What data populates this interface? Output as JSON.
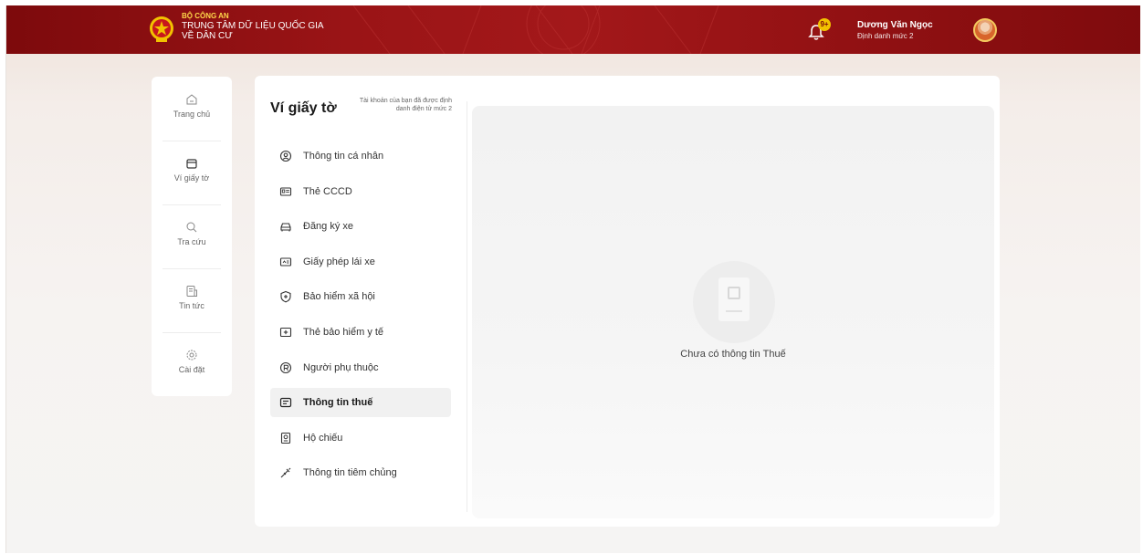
{
  "header": {
    "org_line1": "BỘ CÔNG AN",
    "org_line2": "TRUNG TÂM DỮ LIỆU QUỐC GIA",
    "org_line3": "VỀ DÂN CƯ",
    "notification_badge": "9+",
    "user_name": "Dương Văn Ngọc",
    "user_level": "Định danh mức 2",
    "colors": {
      "primary": "#9a1416",
      "accent": "#ffd84a"
    }
  },
  "leftnav": {
    "items": [
      {
        "label": "Trang chủ",
        "icon": "home-icon"
      },
      {
        "label": "Ví giấy tờ",
        "icon": "wallet-icon"
      },
      {
        "label": "Tra cứu",
        "icon": "search-icon"
      },
      {
        "label": "Tin tức",
        "icon": "news-icon"
      },
      {
        "label": "Cài đặt",
        "icon": "settings-icon"
      }
    ]
  },
  "panel": {
    "title": "Ví giấy tờ",
    "note": "Tài khoản của bạn đã được định danh điện tử mức 2",
    "menu": [
      {
        "label": "Thông tin cá nhân",
        "icon": "user-circle-icon",
        "active": false
      },
      {
        "label": "Thẻ CCCD",
        "icon": "id-card-icon",
        "active": false
      },
      {
        "label": "Đăng ký xe",
        "icon": "car-icon",
        "active": false
      },
      {
        "label": "Giấy phép lái xe",
        "icon": "license-icon",
        "active": false
      },
      {
        "label": "Bảo hiểm xã hội",
        "icon": "shield-plus-icon",
        "active": false
      },
      {
        "label": "Thẻ bảo hiểm y tế",
        "icon": "health-card-icon",
        "active": false
      },
      {
        "label": "Người phụ thuộc",
        "icon": "dependent-icon",
        "active": false
      },
      {
        "label": "Thông tin thuế",
        "icon": "tax-icon",
        "active": true
      },
      {
        "label": "Hộ chiếu",
        "icon": "passport-icon",
        "active": false
      },
      {
        "label": "Thông tin tiêm chủng",
        "icon": "syringe-icon",
        "active": false
      }
    ]
  },
  "content": {
    "empty_message": "Chưa có thông tin Thuế"
  }
}
